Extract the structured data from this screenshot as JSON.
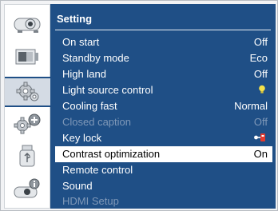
{
  "menu": {
    "title": "Setting",
    "rows": [
      {
        "label": "On start",
        "value": "Off"
      },
      {
        "label": "Standby mode",
        "value": "Eco"
      },
      {
        "label": "High land",
        "value": "Off"
      },
      {
        "label": "Light source control",
        "value": "",
        "icon": "bulb-icon"
      },
      {
        "label": "Cooling fast",
        "value": "Normal"
      },
      {
        "label": "Closed caption",
        "value": "Off"
      },
      {
        "label": "Key lock",
        "value": "",
        "icon": "keylock-icon"
      },
      {
        "label": "Contrast optimization",
        "value": "On"
      },
      {
        "label": "Remote control",
        "value": ""
      },
      {
        "label": "Sound",
        "value": ""
      },
      {
        "label": "HDMI Setup",
        "value": ""
      }
    ]
  },
  "sidebar": {
    "items": [
      {
        "name": "display-icon"
      },
      {
        "name": "image-adjust-icon"
      },
      {
        "name": "setting-gear-icon",
        "active": true
      },
      {
        "name": "expand-gears-icon"
      },
      {
        "name": "usb-memory-icon"
      },
      {
        "name": "info-icon"
      }
    ]
  },
  "colors": {
    "panel_bg": "#1f4f86",
    "selected_bg": "#ffffff",
    "disabled_text": "#7f98b8",
    "bulb": "#f5e24a"
  }
}
